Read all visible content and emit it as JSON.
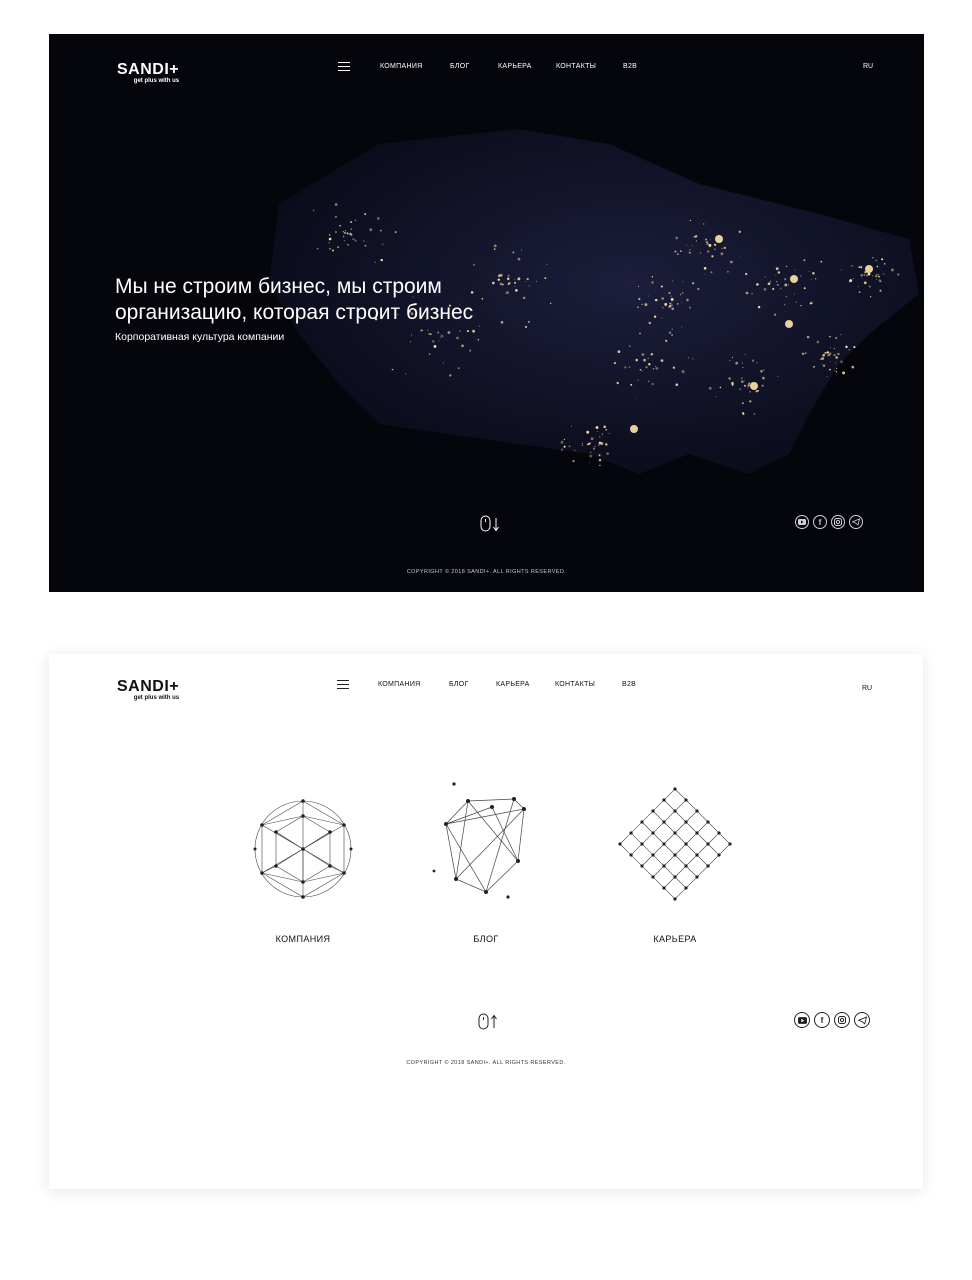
{
  "brand": {
    "name": "SANDI+",
    "tagline": "get plus with us"
  },
  "nav": {
    "items": [
      "КОМПАНИЯ",
      "БЛОГ",
      "КАРЬЕРА",
      "КОНТАКТЫ",
      "B2B"
    ],
    "language": "RU"
  },
  "hero": {
    "headline_line1": "Мы не строим бизнес, мы строим",
    "headline_line2": "организацию, которая строит бизнес",
    "subheadline": "Корпоративная культура компании"
  },
  "cards": [
    {
      "label": "КОМПАНИЯ",
      "icon": "geodesic-sphere-icon"
    },
    {
      "label": "БЛОГ",
      "icon": "polyhedron-network-icon"
    },
    {
      "label": "КАРЬЕРА",
      "icon": "diamond-grid-icon"
    }
  ],
  "socials": [
    "youtube-icon",
    "facebook-icon",
    "instagram-icon",
    "telegram-icon"
  ],
  "footer": {
    "copyright": "COPYRIGHT © 2018 SANDI+. ALL RIGHTS RESERVED."
  },
  "colors": {
    "dark_bg": "#05060c",
    "light_bg": "#ffffff",
    "city_lights": "#ffe6a8"
  }
}
